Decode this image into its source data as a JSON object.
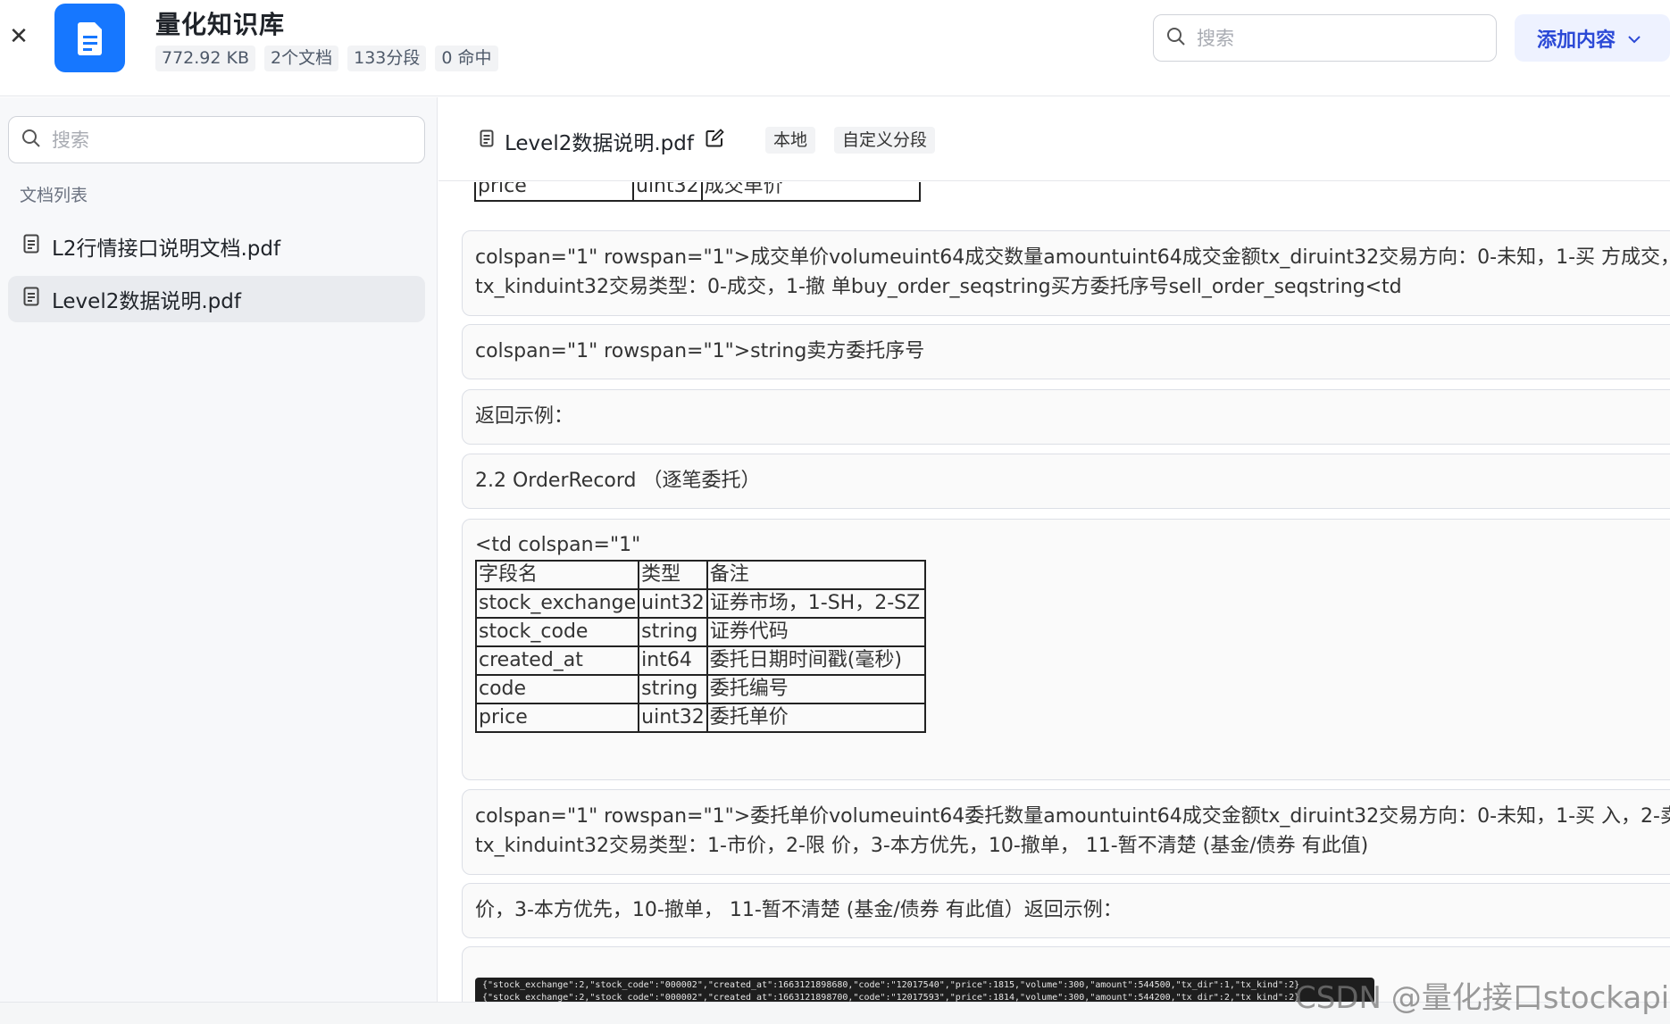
{
  "header": {
    "close_icon": "close-icon",
    "app_icon": "document-icon",
    "title": "量化知识库",
    "stats": [
      "772.92 KB",
      "2个文档",
      "133分段",
      "0 命中"
    ],
    "search_placeholder": "搜索",
    "add_button_label": "添加内容"
  },
  "sidebar": {
    "search_placeholder": "搜索",
    "list_title": "文档列表",
    "documents": [
      {
        "name": "L2行情接口说明文档.pdf",
        "active": false
      },
      {
        "name": "Level2数据说明.pdf",
        "active": true
      }
    ]
  },
  "main": {
    "file_name": "Level2数据说明.pdf",
    "tags": [
      "本地",
      "自定义分段"
    ],
    "top_table_row": [
      "price",
      "uint32",
      "成交单价"
    ],
    "segments": [
      {
        "lines": [
          "colspan=\"1\" rowspan=\"1\">成交单价volumeuint64成交数量amountuint64成交金额tx_diruint32交易方向：0-未知，1-买 方成交，",
          "tx_kinduint32交易类型：0-成交，1-撤 单buy_order_seqstring买方委托序号sell_order_seqstring<td"
        ]
      },
      {
        "lines": [
          "colspan=\"1\" rowspan=\"1\">string卖方委托序号"
        ]
      },
      {
        "lines": [
          "返回示例："
        ]
      },
      {
        "lines": [
          "2.2 OrderRecord （逐笔委托）"
        ]
      },
      {
        "lines": [
          "<td colspan=\"1\""
        ]
      },
      {
        "lines": [
          "colspan=\"1\" rowspan=\"1\">委托单价volumeuint64委托数量amountuint64成交金额tx_diruint32交易方向：0-未知，1-买 入，2-卖",
          "tx_kinduint32交易类型：1-市价，2-限 价，3-本方优先，10-撤单， 11-暂不清楚 (基金/债券 有此值)"
        ]
      },
      {
        "lines": [
          "价，3-本方优先，10-撤单， 11-暂不清楚 (基金/债券 有此值）返回示例："
        ]
      }
    ],
    "order_table": [
      [
        "字段名",
        "类型",
        "备注"
      ],
      [
        "stock_exchange",
        "uint32",
        "证券市场，1-SH，2-SZ"
      ],
      [
        "stock_code",
        "string",
        "证券代码"
      ],
      [
        "created_at",
        "int64",
        "委托日期时间戳(毫秒)"
      ],
      [
        "code",
        "string",
        "委托编号"
      ],
      [
        "price",
        "uint32",
        "委托单价"
      ]
    ],
    "code_lines": [
      "{\"stock_exchange\":2,\"stock_code\":\"000002\",\"created_at\":1663121898680,\"code\":\"12017540\",\"price\":1815,\"volume\":300,\"amount\":544500,\"tx_dir\":1,\"tx_kind\":2}",
      "{\"stock_exchange\":2,\"stock_code\":\"000002\",\"created_at\":1663121898700,\"code\":\"12017593\",\"price\":1814,\"volume\":300,\"amount\":544200,\"tx_dir\":2,\"tx_kind\":2}"
    ]
  },
  "watermark": "CSDN @量化接口stockapi",
  "colors": {
    "accent": "#1677ff",
    "add_button_bg": "#eef2ff",
    "add_button_text": "#2b49d6",
    "sidebar_bg": "#f7f8fa"
  }
}
